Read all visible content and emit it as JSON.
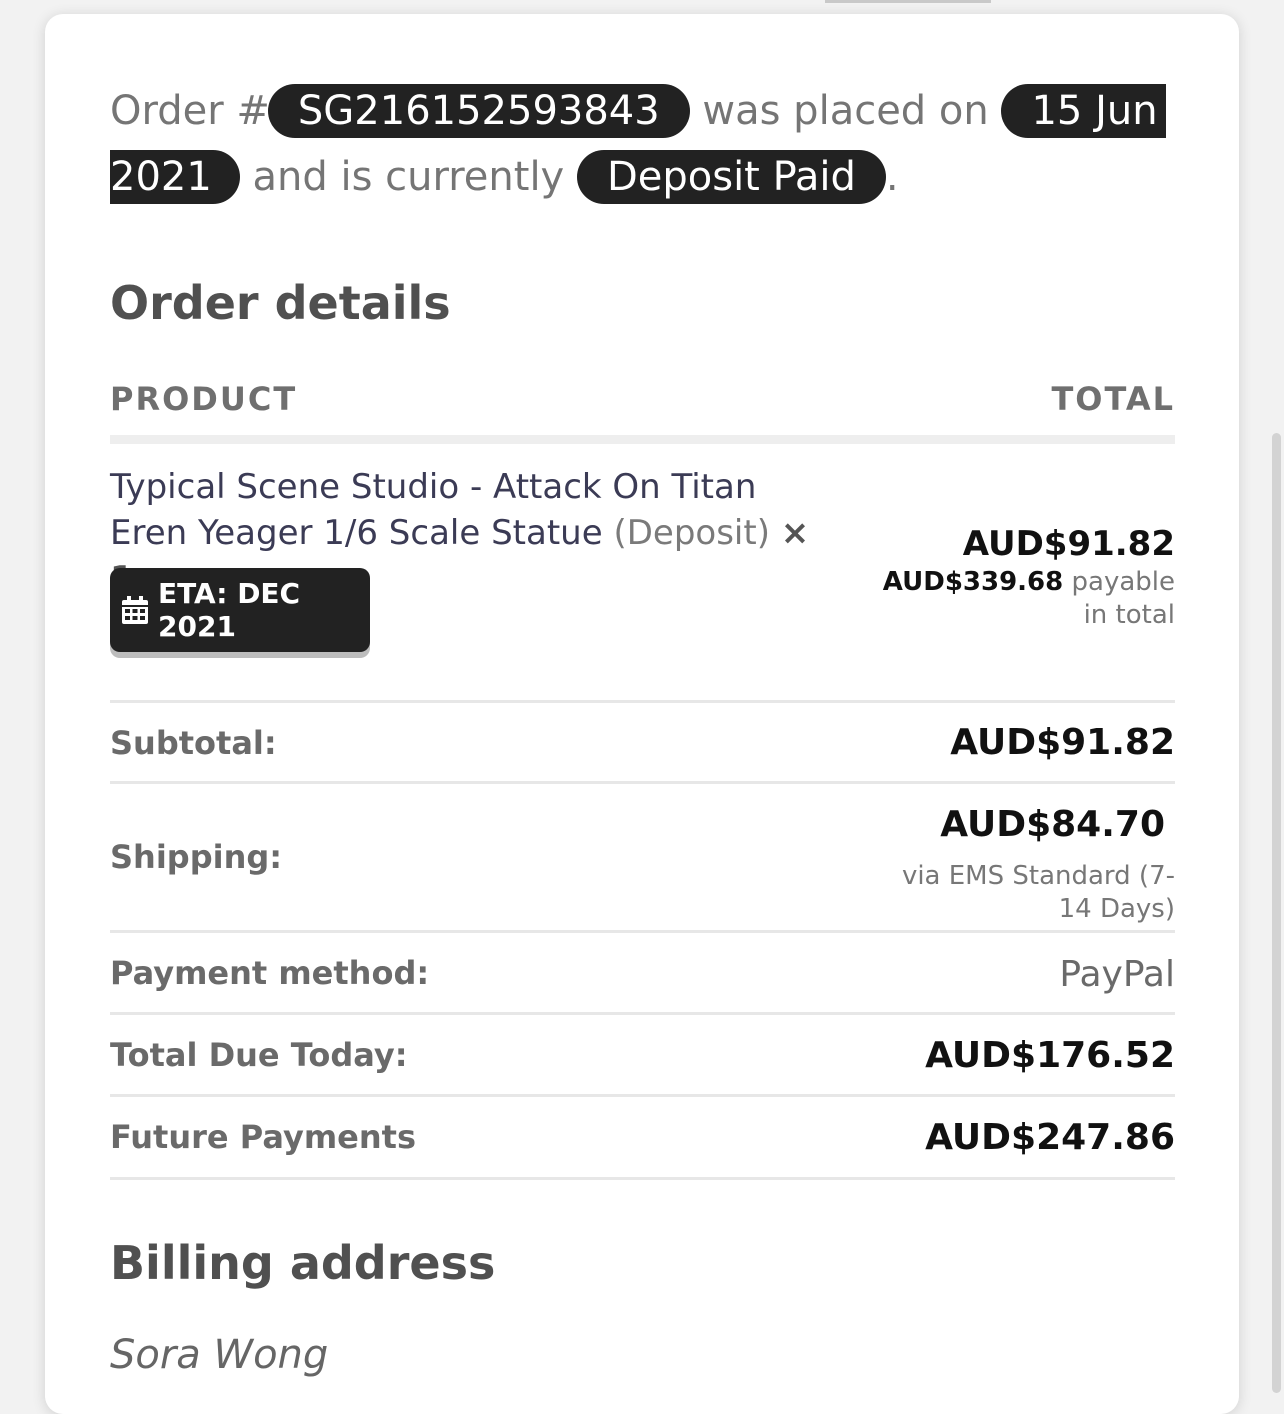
{
  "intro": {
    "order_prefix": "Order #",
    "order_number": "SG216152593843",
    "placed_text": " was placed on ",
    "date_part1": "15 Jun",
    "date_part2": "2021",
    "status_text": " and is currently ",
    "status": "Deposit Paid",
    "end": "."
  },
  "order_details": {
    "title": "Order details",
    "col_product": "PRODUCT",
    "col_total": "TOTAL",
    "item": {
      "name_line1": "Typical Scene Studio - Attack On Titan",
      "name_line2": "Eren Yeager 1/6 Scale Statue",
      "tag": "(Deposit)",
      "qty": "× 1",
      "eta": "ETA: DEC 2021",
      "total": "AUD$91.82",
      "payable_amount": "AUD$339.68",
      "payable_text": "payable in total"
    },
    "rows": {
      "subtotal_label": "Subtotal:",
      "subtotal_value": "AUD$91.82",
      "shipping_label": "Shipping:",
      "shipping_value": "AUD$84.70",
      "shipping_note": "via EMS Standard (7-14 Days)",
      "payment_label": "Payment method:",
      "payment_value": "PayPal",
      "due_label": "Total Due Today:",
      "due_value": "AUD$176.52",
      "future_label": "Future Payments",
      "future_value": "AUD$247.86"
    }
  },
  "billing": {
    "title": "Billing address",
    "name": "Sora Wong"
  }
}
